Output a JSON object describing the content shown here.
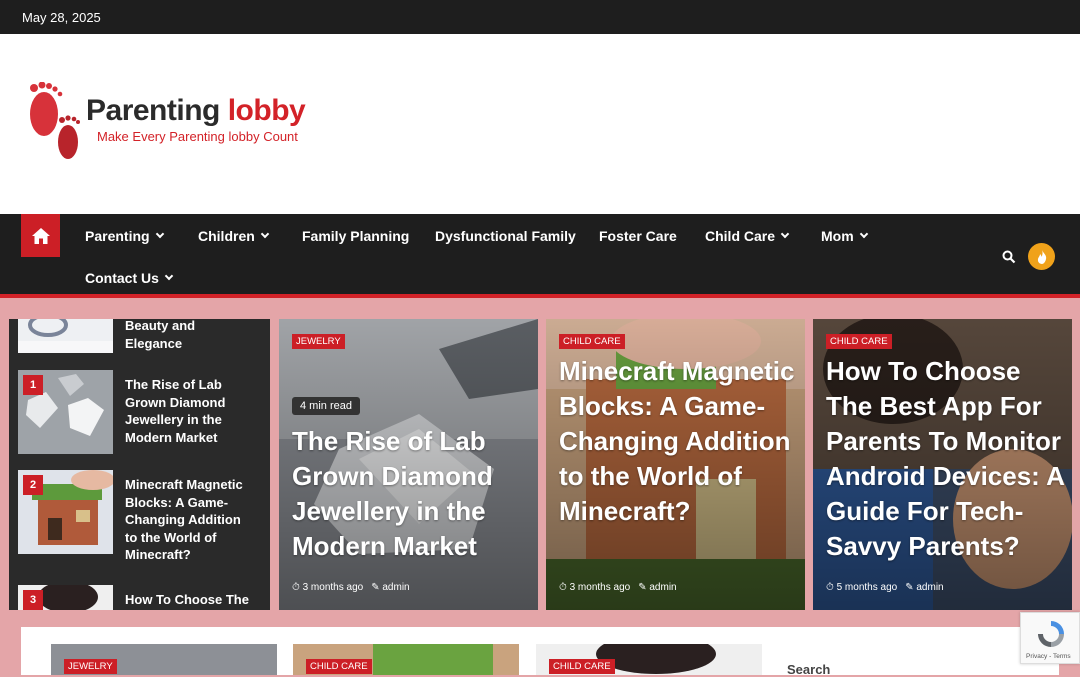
{
  "topbar": {
    "date": "May 28, 2025"
  },
  "logo": {
    "title_main": "Parenting ",
    "title_accent": "lobby",
    "tagline": "Make Every Parenting lobby Count"
  },
  "nav": {
    "items": [
      {
        "label": "Parenting",
        "dropdown": true
      },
      {
        "label": "Children",
        "dropdown": true
      },
      {
        "label": "Family Planning",
        "dropdown": false
      },
      {
        "label": "Dysfunctional Family",
        "dropdown": false
      },
      {
        "label": "Foster Care",
        "dropdown": false
      },
      {
        "label": "Child Care",
        "dropdown": true
      },
      {
        "label": "Mom",
        "dropdown": true
      },
      {
        "label": "Contact Us",
        "dropdown": true
      }
    ],
    "accent": "#cc1f26"
  },
  "sidebar": {
    "partial_title": "Beauty and Elegance",
    "items": [
      {
        "num": "1",
        "title": "The Rise of Lab Grown Diamond Jewellery in the Modern Market"
      },
      {
        "num": "2",
        "title": "Minecraft Magnetic Blocks: A Game-Changing Addition to the World of Minecraft?"
      },
      {
        "num": "3",
        "title": "How To Choose The Best App For"
      }
    ]
  },
  "featured": [
    {
      "category": "JEWELRY",
      "read_time": "4 min read",
      "title": "The Rise of Lab Grown Diamond Jewellery in the Modern Market",
      "time": "3 months ago",
      "author": "admin"
    },
    {
      "category": "CHILD CARE",
      "title": "Minecraft Magnetic Blocks: A Game-Changing Addition to the World of Minecraft?",
      "time": "3 months ago",
      "author": "admin"
    },
    {
      "category": "CHILD CARE",
      "title": "How To Choose The Best App For Parents To Monitor Android Devices: A Guide For Tech-Savvy Parents?",
      "time": "5 months ago",
      "author": "admin"
    }
  ],
  "bottom": {
    "cards": [
      {
        "category": "JEWELRY"
      },
      {
        "category": "CHILD CARE"
      },
      {
        "category": "CHILD CARE"
      }
    ],
    "search_label": "Search"
  },
  "recaptcha": {
    "label": "Privacy - Terms"
  }
}
